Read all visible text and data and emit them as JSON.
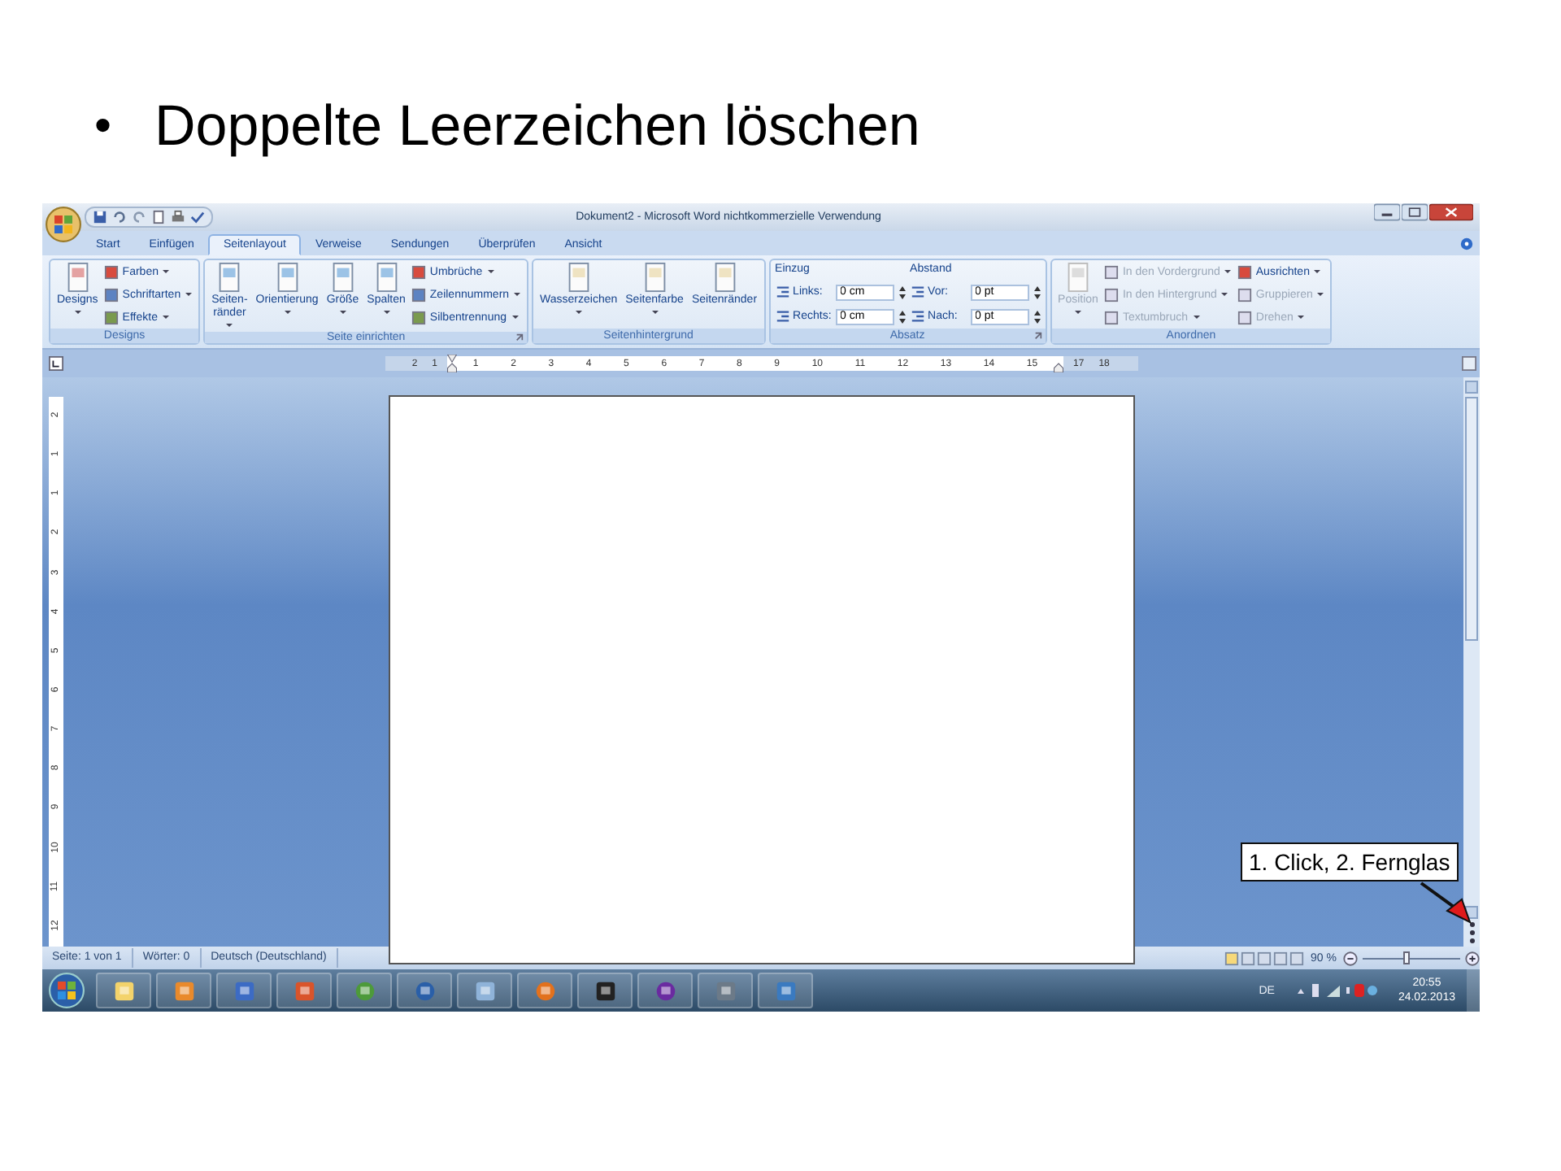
{
  "slide": {
    "bullet": "•",
    "title": "Doppelte Leerzeichen löschen"
  },
  "window": {
    "title": "Dokument2 - Microsoft Word nichtkommerzielle Verwendung"
  },
  "tabs": [
    {
      "label": "Start",
      "selected": false
    },
    {
      "label": "Einfügen",
      "selected": false
    },
    {
      "label": "Seitenlayout",
      "selected": true
    },
    {
      "label": "Verweise",
      "selected": false
    },
    {
      "label": "Sendungen",
      "selected": false
    },
    {
      "label": "Überprüfen",
      "selected": false
    },
    {
      "label": "Ansicht",
      "selected": false
    }
  ],
  "ribbon": {
    "groups": [
      {
        "name": "Designs",
        "launcher": false,
        "columns": [
          [
            {
              "kind": "large",
              "lines": [
                "Designs"
              ],
              "dropdown": true,
              "disabled": false
            }
          ],
          [
            {
              "kind": "small",
              "label": "Farben",
              "dropdown": true,
              "disabled": false
            },
            {
              "kind": "small",
              "label": "Schriftarten",
              "dropdown": true,
              "disabled": false
            },
            {
              "kind": "small",
              "label": "Effekte",
              "dropdown": true,
              "disabled": false
            }
          ]
        ]
      },
      {
        "name": "Seite einrichten",
        "launcher": true,
        "columns": [
          [
            {
              "kind": "large",
              "lines": [
                "Seiten-",
                "ränder"
              ],
              "dropdown": true,
              "disabled": false
            }
          ],
          [
            {
              "kind": "large",
              "lines": [
                "Orientierung"
              ],
              "dropdown": true,
              "disabled": false
            }
          ],
          [
            {
              "kind": "large",
              "lines": [
                "Größe"
              ],
              "dropdown": true,
              "disabled": false
            }
          ],
          [
            {
              "kind": "large",
              "lines": [
                "Spalten"
              ],
              "dropdown": true,
              "disabled": false
            }
          ],
          [
            {
              "kind": "small",
              "label": "Umbrüche",
              "dropdown": true,
              "disabled": false
            },
            {
              "kind": "small",
              "label": "Zeilennummern",
              "dropdown": true,
              "disabled": false
            },
            {
              "kind": "small",
              "label": "Silbentrennung",
              "dropdown": true,
              "disabled": false
            }
          ]
        ]
      },
      {
        "name": "Seitenhintergrund",
        "launcher": false,
        "columns": [
          [
            {
              "kind": "large",
              "lines": [
                "Wasserzeichen"
              ],
              "dropdown": true,
              "disabled": false
            }
          ],
          [
            {
              "kind": "large",
              "lines": [
                "Seitenfarbe"
              ],
              "dropdown": true,
              "disabled": false
            }
          ],
          [
            {
              "kind": "large",
              "lines": [
                "Seitenränder"
              ],
              "dropdown": false,
              "disabled": false
            }
          ]
        ]
      },
      {
        "name": "Absatz",
        "launcher": true,
        "columns": [
          [
            {
              "kind": "heading",
              "label": "Einzug"
            },
            {
              "kind": "spin",
              "label": "Links:",
              "value": "0 cm"
            },
            {
              "kind": "spin",
              "label": "Rechts:",
              "value": "0 cm"
            }
          ],
          [
            {
              "kind": "heading",
              "label": "Abstand"
            },
            {
              "kind": "spin",
              "label": "Vor:",
              "value": "0 pt"
            },
            {
              "kind": "spin",
              "label": "Nach:",
              "value": "0 pt"
            }
          ]
        ]
      },
      {
        "name": "Anordnen",
        "launcher": false,
        "columns": [
          [
            {
              "kind": "large",
              "lines": [
                "Position"
              ],
              "dropdown": true,
              "disabled": true
            }
          ],
          [
            {
              "kind": "small",
              "label": "In den Vordergrund",
              "dropdown": true,
              "disabled": true
            },
            {
              "kind": "small",
              "label": "In den Hintergrund",
              "dropdown": true,
              "disabled": true
            },
            {
              "kind": "small",
              "label": "Textumbruch",
              "dropdown": true,
              "disabled": true
            }
          ],
          [
            {
              "kind": "small",
              "label": "Ausrichten",
              "dropdown": true,
              "disabled": false
            },
            {
              "kind": "small",
              "label": "Gruppieren",
              "dropdown": true,
              "disabled": true
            },
            {
              "kind": "small",
              "label": "Drehen",
              "dropdown": true,
              "disabled": true
            }
          ]
        ]
      }
    ]
  },
  "ruler": {
    "left_marks": [
      "2",
      "1"
    ],
    "marks": [
      "1",
      "2",
      "3",
      "4",
      "5",
      "6",
      "7",
      "8",
      "9",
      "10",
      "11",
      "12",
      "13",
      "14",
      "15"
    ],
    "right_marks": [
      "17",
      "18"
    ]
  },
  "vertical_ruler": {
    "marks": [
      "2",
      "1",
      "1",
      "2",
      "3",
      "4",
      "5",
      "6",
      "7",
      "8",
      "9",
      "10",
      "11",
      "12"
    ]
  },
  "status_bar": {
    "items": [
      "Seite: 1 von 1",
      "Wörter: 0",
      "Deutsch (Deutschland)"
    ],
    "zoom": "90 %",
    "zoom_slider": {
      "level": 0.45
    }
  },
  "taskbar": {
    "language": "DE",
    "time": "20:55",
    "date": "24.02.2013"
  },
  "callout": {
    "text": "1. Click, 2. Fernglas"
  }
}
